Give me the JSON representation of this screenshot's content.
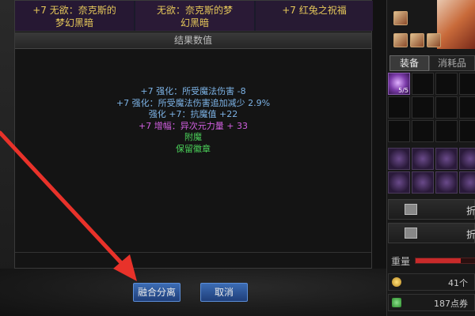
{
  "top_row": {
    "items": [
      {
        "line1": "+7 无欲：奈克斯的",
        "line2": "梦幻黑暗"
      },
      {
        "line1": "无欲：奈克斯的梦",
        "line2": "幻黑暗"
      },
      {
        "line1": "+7 红兔之祝福",
        "line2": ""
      }
    ]
  },
  "results": {
    "header": "结果数值",
    "lines": [
      {
        "text": "+7 强化：所受魔法伤害 -8",
        "color": "blue"
      },
      {
        "text": "+7 强化：所受魔法伤害追加减少 2.9%",
        "color": "blue"
      },
      {
        "text": "强化 +7：抗魔值 +22",
        "color": "blue"
      },
      {
        "text": "+7 增幅：异次元力量 + 33",
        "color": "purple"
      },
      {
        "text": "附魔",
        "color": "green"
      },
      {
        "text": "保留徽章",
        "color": "green"
      }
    ]
  },
  "buttons": {
    "fuse": "融合分离",
    "cancel": "取消"
  },
  "inventory": {
    "tabs": [
      "装备",
      "消耗品"
    ],
    "first_item_qty": "5/5",
    "action1_label": "折",
    "action2_label": "折",
    "weight_label": "重量",
    "weight_fraction": 0.75,
    "gold": "41个",
    "cera": "187点券"
  },
  "colors": {
    "blue": "#7db3e6",
    "purple": "#d15fe0",
    "green": "#4bd25a",
    "arrow": "#e8322a"
  }
}
